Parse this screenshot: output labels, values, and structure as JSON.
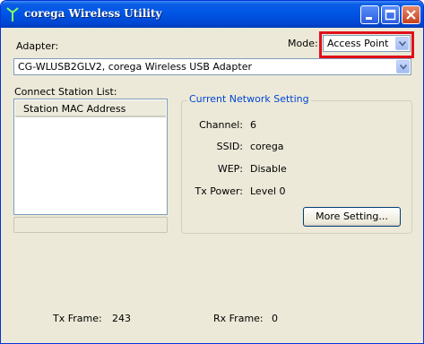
{
  "window": {
    "title": "corega Wireless Utility"
  },
  "adapter": {
    "label": "Adapter:",
    "selected": "CG-WLUSB2GLV2, corega Wireless USB Adapter"
  },
  "mode": {
    "label": "Mode:",
    "selected": "Access Point"
  },
  "stations": {
    "label": "Connect Station List:",
    "column": "Station MAC Address",
    "rows": []
  },
  "network": {
    "title": "Current Network Setting",
    "channel_label": "Channel:",
    "channel": "6",
    "ssid_label": "SSID:",
    "ssid": "corega",
    "wep_label": "WEP:",
    "wep": "Disable",
    "txpower_label": "Tx Power:",
    "txpower": "Level 0",
    "more_button": "More Setting..."
  },
  "stats": {
    "tx_label": "Tx Frame:",
    "tx": "243",
    "rx_label": "Rx Frame:",
    "rx": "0"
  },
  "colors": {
    "highlight": "#e0101a",
    "titlebar": "#0055e5",
    "group_title": "#0046d5"
  }
}
